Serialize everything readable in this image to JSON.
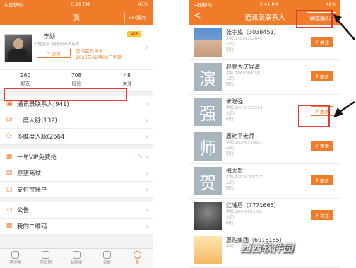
{
  "left": {
    "status": {
      "carrier": "中国移动",
      "time": "5:29 PM",
      "battery": "47%"
    },
    "nav": {
      "title": "我",
      "vip_service": "VIP服务"
    },
    "profile": {
      "name": "李勋",
      "signature": "个性签名: 创造而不占有成...",
      "sign_button": "签到",
      "vip_line1": "您的会员将于",
      "vip_line2": "2026年02月06日到期",
      "vip_badge": "VIP"
    },
    "stats": [
      {
        "num": "260",
        "label": "好友"
      },
      {
        "num": "708",
        "label": "粉丝"
      },
      {
        "num": "48",
        "label": "关注"
      }
    ],
    "menu1": [
      {
        "label": "通讯录联系人(941)",
        "icon": "contacts-icon"
      },
      {
        "label": "一度人脉(132)",
        "icon": "people-icon"
      },
      {
        "label": "多维度人脉(2564)",
        "icon": "network-icon"
      }
    ],
    "menu2": [
      {
        "label": "十年VIP免费抢",
        "icon": "vip-icon"
      },
      {
        "label": "愿望商城",
        "icon": "mall-icon"
      },
      {
        "label": "支付宝账户",
        "icon": "alipay-icon"
      }
    ],
    "menu3": [
      {
        "label": "公告",
        "icon": "announce-icon"
      },
      {
        "label": "我的二维码",
        "icon": "qrcode-icon"
      }
    ],
    "tabs": [
      "黑贝圈",
      "黑贝圈",
      "脉脉堂",
      "买单",
      "我"
    ]
  },
  "right": {
    "status": {
      "carrier": "中国移动",
      "time": "5:41 PM",
      "battery": "48%"
    },
    "nav": {
      "title": "通讯录联系人",
      "read_button": "读取通讯录",
      "back": "<"
    },
    "contacts": [
      {
        "name": "张宇成（3038451）",
        "phone": "手机:15901352645",
        "company": "公司:",
        "position": "职位:",
        "button": "关注",
        "avatar": "photo1",
        "avatar_char": ""
      },
      {
        "name": "赵亮大庆导演",
        "phone": "手机:18603691581",
        "company": "公司:",
        "position": "职位:",
        "button": "邀请",
        "avatar": "char",
        "avatar_char": "演"
      },
      {
        "name": "米晓强",
        "phone": "手机:15376722229",
        "company": "公司:",
        "position": "职位:",
        "button": "邀请",
        "avatar": "char",
        "avatar_char": "强"
      },
      {
        "name": "扈艳平老师",
        "phone": "手机:18346558851",
        "company": "公司:",
        "position": "职位:",
        "button": "邀请",
        "avatar": "char",
        "avatar_char": "师"
      },
      {
        "name": "梅大贺",
        "phone": "手机:13918758717",
        "company": "公司:",
        "position": "职位:",
        "button": "邀请",
        "avatar": "char",
        "avatar_char": "贺"
      },
      {
        "name": "红嘴唇（7771665）",
        "phone": "手机:18946051262",
        "company": "公司:",
        "position": "职位:",
        "button": "关注",
        "avatar": "photo2",
        "avatar_char": ""
      },
      {
        "name": "惠购集团（6916155）",
        "phone": "手机:",
        "company": "",
        "position": "",
        "button": "",
        "avatar": "photo3",
        "avatar_char": ""
      }
    ]
  },
  "watermark": "西西软件园"
}
